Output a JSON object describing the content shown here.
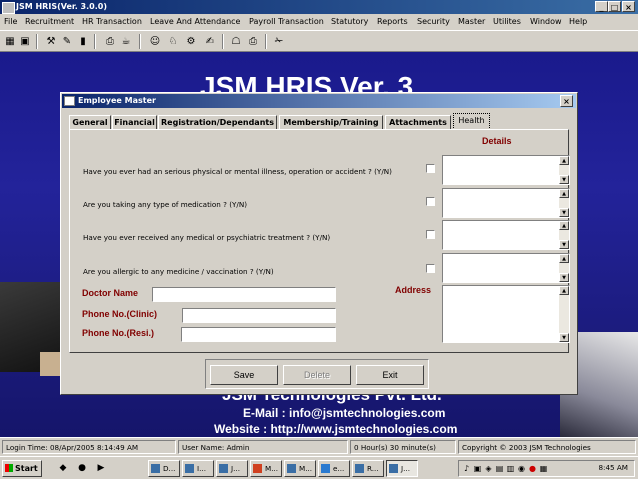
{
  "window": {
    "title": "JSM HRIS(Ver. 3.0.0)",
    "minimize": "_",
    "restore": "□",
    "close": "×"
  },
  "menu": [
    "File",
    "Recruitment",
    "HR Transaction",
    "Leave And Attendance",
    "Payroll Transaction",
    "Statutory",
    "Reports",
    "Security",
    "Master",
    "Utilites",
    "Window",
    "Help"
  ],
  "toolbar": {
    "icons": [
      "▦",
      "▣",
      "⚒",
      "✎",
      "▮",
      "⎙",
      "☕",
      "☺",
      "♘",
      "⚙",
      "✍",
      "☖",
      "⎙",
      "✁"
    ]
  },
  "background": {
    "title": "JSM HRIS Ver. 3",
    "company": "JSM Technologies Pvt. Ltd.",
    "email": "E-Mail : info@jsmtechnologies.com",
    "website": "Website : http://www.jsmtechnologies.com"
  },
  "dialog": {
    "title": "Employee Master",
    "close": "×",
    "tabs": [
      {
        "label": "General",
        "active": false
      },
      {
        "label": "Financial",
        "active": false
      },
      {
        "label": "Registration/Dependants",
        "active": false
      },
      {
        "label": "Membership/Training",
        "active": false
      },
      {
        "label": "Attachments",
        "active": false
      },
      {
        "label": "Health",
        "active": true
      }
    ],
    "details_header": "Details",
    "questions": [
      {
        "text": "Have you ever had an serious physical or mental  illness, operation or accident ? (Y/N)",
        "checked": false,
        "details": ""
      },
      {
        "text": "Are you taking any type  of medication ? (Y/N)",
        "checked": false,
        "details": ""
      },
      {
        "text": "Have you ever received any medical or psychiatric treatment ? (Y/N)",
        "checked": false,
        "details": ""
      },
      {
        "text": "Are you allergic to any medicine / vaccination ? (Y/N)",
        "checked": false,
        "details": ""
      }
    ],
    "doctor_name_label": "Doctor Name",
    "doctor_name_value": "",
    "phone_clinic_label": "Phone No.(Clinic)",
    "phone_clinic_value": "",
    "phone_resi_label": "Phone No.(Resi.)",
    "phone_resi_value": "",
    "address_label": "Address",
    "address_value": "",
    "scroll_up": "▲",
    "scroll_down": "▼",
    "buttons": {
      "save": "Save",
      "delete": "Delete",
      "exit": "Exit"
    }
  },
  "statusbar": {
    "login_time": "Login Time: 08/Apr/2005 8:14:49 AM",
    "user_name": "User Name: Admin",
    "session": "0 Hour(s) 30 minute(s)",
    "copyright": "Copyright  © 2003  JSM Technologies"
  },
  "taskbar": {
    "start": "Start",
    "quicklaunch": [
      "◆",
      "●",
      "▶"
    ],
    "tasks": [
      "D...",
      "I...",
      "J...",
      "M...",
      "M...",
      "e...",
      "R...",
      "J..."
    ],
    "tray_icons": [
      "♪",
      "▣",
      "◈",
      "▤",
      "▥",
      "◉",
      "●",
      "▦"
    ],
    "clock": "8:45 AM"
  },
  "colors": {
    "accent_title": "#0a246a",
    "label_maroon": "#800000",
    "background_blue": "#1a1a8c"
  }
}
